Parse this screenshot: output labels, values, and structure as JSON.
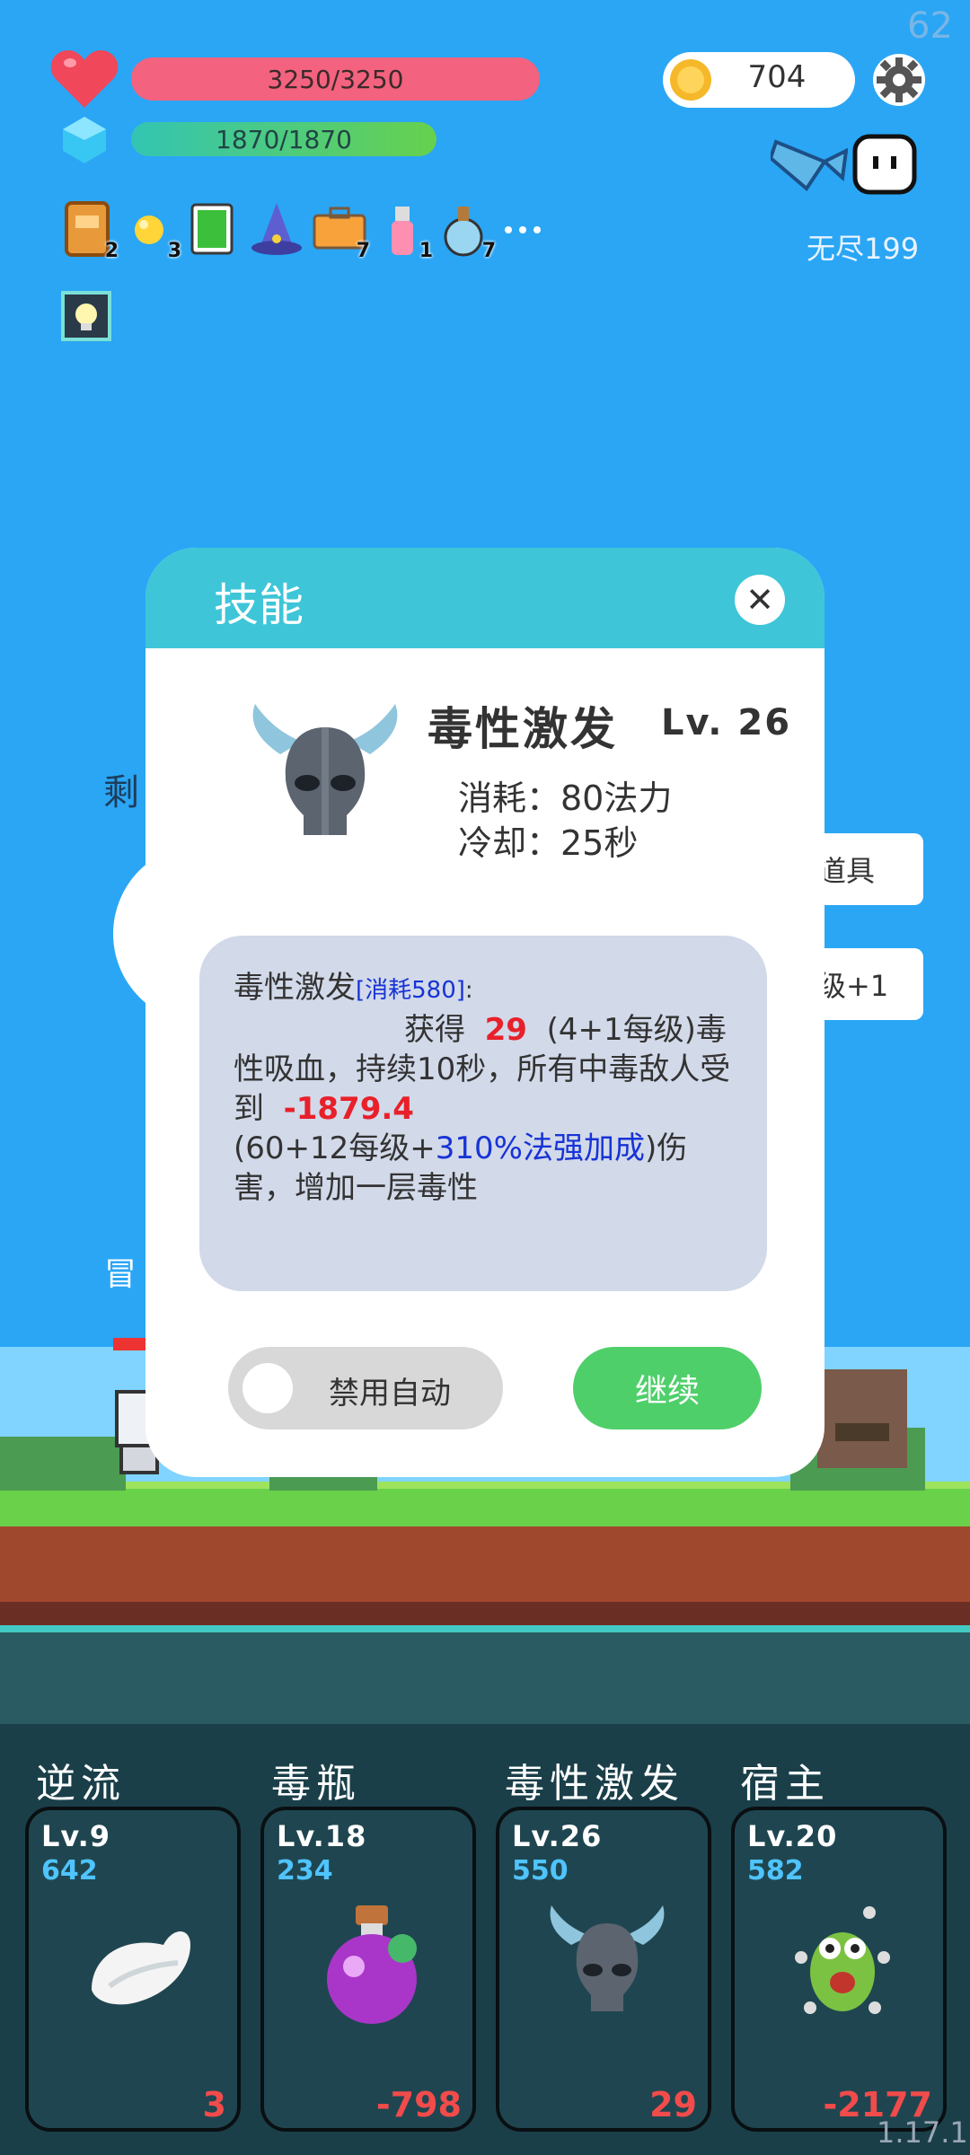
{
  "hud": {
    "fps": "62",
    "hp": "3250/3250",
    "mp": "1870/1870",
    "coins": "704",
    "endless": "无尽199",
    "version": "1.17.1"
  },
  "items": [
    {
      "name": "book",
      "count": "2"
    },
    {
      "name": "sun-orb",
      "count": "3"
    },
    {
      "name": "green-card",
      "count": ""
    },
    {
      "name": "wizard-hat",
      "count": ""
    },
    {
      "name": "suitcase",
      "count": "7"
    },
    {
      "name": "spray-bottle",
      "count": "1"
    },
    {
      "name": "potion-flask",
      "count": "7"
    }
  ],
  "background": {
    "left_fragment": "剩",
    "side_button_1": "道具",
    "side_button_2": "级+1",
    "adventurer_fragment": "冒"
  },
  "dialog": {
    "title": "技能",
    "skill_name": "毒性激发",
    "skill_level": "Lv. 26",
    "cost": "消耗：80法力",
    "cooldown": "冷却：25秒",
    "desc": {
      "name": "毒性激发",
      "cost_tag": "[消耗580]",
      "colon": ":",
      "p1": "获得",
      "v1": "29",
      "p2": "(4+1每级)毒性吸血，持续10秒，所有中毒敌人受到",
      "v2": "-1879.4",
      "p3": "(60+12每级+",
      "v3": "310%法强加成",
      "p4": ")伤害，增加一层毒性"
    },
    "toggle_label": "禁用自动",
    "continue_label": "继续"
  },
  "skill_cards": [
    {
      "title": "逆流",
      "level": "Lv.9",
      "cost": "642",
      "value": "3",
      "icon": "wing-icon"
    },
    {
      "title": "毒瓶",
      "level": "Lv.18",
      "cost": "234",
      "value": "-798",
      "icon": "poison-bottle-icon"
    },
    {
      "title": "毒性激发",
      "level": "Lv.26",
      "cost": "550",
      "value": "29",
      "icon": "horned-skull-icon"
    },
    {
      "title": "宿主",
      "level": "Lv.20",
      "cost": "582",
      "value": "-2177",
      "icon": "green-monster-icon"
    }
  ],
  "colors": {
    "sky": "#2aa6f5",
    "hp": "#f3627e",
    "dialog_header": "#3ec5d8",
    "continue": "#4fcf6a",
    "damage_red": "#e8202a"
  }
}
